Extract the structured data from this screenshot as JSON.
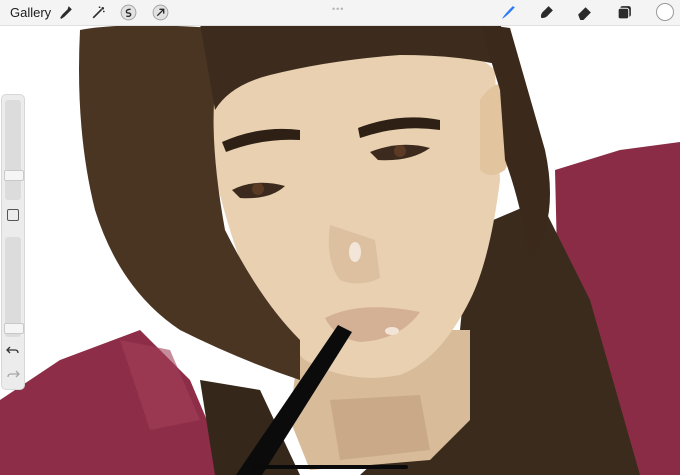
{
  "toolbar": {
    "gallery_label": "Gallery",
    "left_icons": [
      "wrench-icon",
      "magic-wand-icon",
      "selection-icon",
      "transform-arrow-icon"
    ],
    "right_icons": [
      "brush-icon",
      "smudge-icon",
      "eraser-icon",
      "layers-icon"
    ],
    "active_tool": "brush-icon",
    "current_color": "#ffffff",
    "accent_color": "#2f7cf6"
  },
  "sidebar": {
    "brush_size_level": 0.22,
    "opacity_level": 0.05,
    "icons": [
      "modify-square-icon",
      "undo-icon",
      "redo-icon"
    ]
  }
}
